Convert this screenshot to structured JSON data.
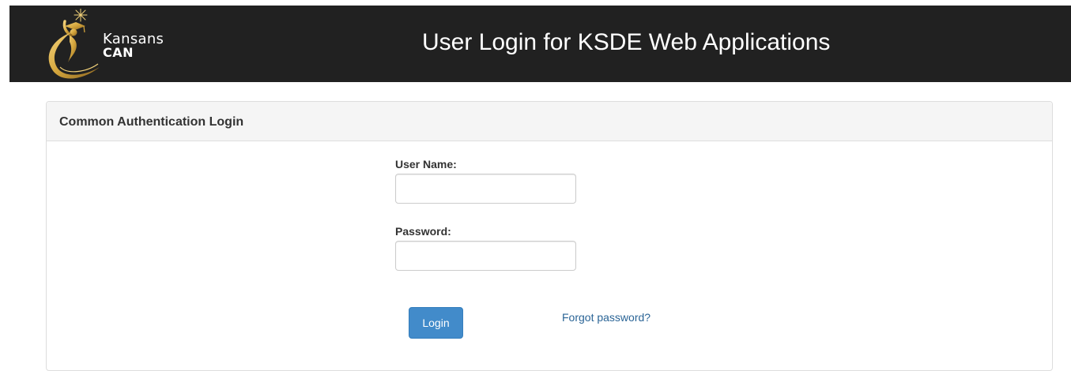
{
  "header": {
    "logo_line1": "Kansans",
    "logo_line2": "CAN",
    "title": "User Login for KSDE Web Applications"
  },
  "panel": {
    "heading": "Common Authentication Login"
  },
  "form": {
    "username_label": "User Name:",
    "username_value": "",
    "password_label": "Password:",
    "password_value": "",
    "login_label": "Login",
    "forgot_label": "Forgot password?"
  },
  "colors": {
    "header_bg": "#212121",
    "logo_gold": "#d4a53c",
    "button_bg": "#428bca",
    "link": "#2a6496"
  },
  "icons": {
    "logo": "kansans-can-logo"
  }
}
